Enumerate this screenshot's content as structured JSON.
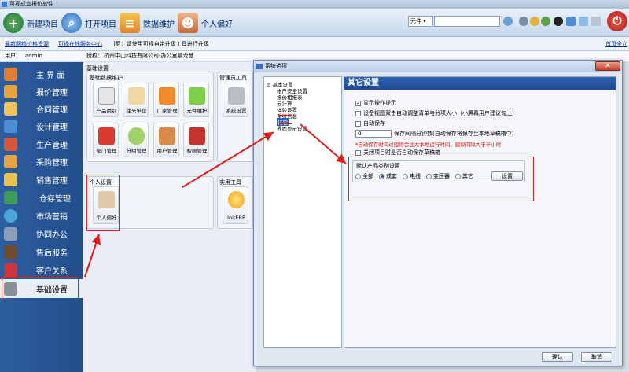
{
  "window": {
    "title": "可视成套报价软件"
  },
  "toolbar": {
    "new_project": "新建项目",
    "open_project": "打开项目",
    "data_maintenance": "数据维护",
    "preferences": "个人偏好",
    "search_select": "元件"
  },
  "linkbar": {
    "link1": "最新网络价格资源",
    "link2": "可视在线服务中心",
    "notice": "]尼：请使用可视自带升级工具进行升级",
    "right": "首页全立"
  },
  "userbar": {
    "user_label": "用户：",
    "user_value": "admin",
    "auth_label": "授权：",
    "auth_value": "杭州中山科技有限公司-办公室慕龙慧"
  },
  "sidebar": {
    "items": [
      {
        "label": "主 界 面",
        "icon": "home-icon",
        "color": "#e57b2c"
      },
      {
        "label": "报价管理",
        "icon": "quote-icon",
        "color": "#e8a23a"
      },
      {
        "label": "合同管理",
        "icon": "contract-icon",
        "color": "#f0c35a"
      },
      {
        "label": "设计管理",
        "icon": "design-icon",
        "color": "#4d8fd6"
      },
      {
        "label": "生产管理",
        "icon": "production-icon",
        "color": "#d9563b"
      },
      {
        "label": "采购管理",
        "icon": "cart-icon",
        "color": "#e7a33d"
      },
      {
        "label": "销售管理",
        "icon": "sales-icon",
        "color": "#e8c44f"
      },
      {
        "label": "仓存管理",
        "icon": "warehouse-icon",
        "color": "#3e9b5a"
      },
      {
        "label": "市场营销",
        "icon": "pie-chart-icon",
        "color": "#4aa7de"
      },
      {
        "label": "协同办公",
        "icon": "collab-icon",
        "color": "#8d9fb8"
      },
      {
        "label": "售后服务",
        "icon": "service-icon",
        "color": "#6f4c2e"
      },
      {
        "label": "客户关系",
        "icon": "customer-icon",
        "color": "#d2333e"
      },
      {
        "label": "基础设置",
        "icon": "tools-icon",
        "color": "#8a8f99"
      }
    ]
  },
  "main": {
    "section_title": "基础设置",
    "basic_data_title": "基础数据维护",
    "admin_tools_title": "管理员工具",
    "personal_title": "个人设置",
    "utility_title": "实用工具",
    "tiles": [
      {
        "label": "产品类别"
      },
      {
        "label": "往来单位"
      },
      {
        "label": "厂家管理"
      },
      {
        "label": "元件维护"
      },
      {
        "label": "部门管理"
      },
      {
        "label": "分组管理"
      },
      {
        "label": "用户管理"
      },
      {
        "label": "权限管理"
      }
    ],
    "system_settings": "系统设置",
    "personal_pref": "个人偏好",
    "init_erp": "InitERP"
  },
  "dialog": {
    "title": "系统选项",
    "tree": {
      "root": "基本设置",
      "children": [
        "帐户安全设置",
        "报价相报表",
        "云计算",
        "体验设置",
        "系统信息",
        "其它",
        "界面显示设置"
      ]
    },
    "content_title": "其它设置",
    "options": {
      "show_tip": "显示操作提示",
      "view_adjust": "设备视图双击自动调整清单与分项大小（小屏幕用户建议勾上）",
      "autosave": "自动保存",
      "autosave_value": "0",
      "autosave_suffix": "保存间隔分钟数(自动保存将保存至本地草稿箱中)",
      "warning": "*自动保存时间过短将会加大本地运行时间，建议间隔大于半小时",
      "close_prompt": "关闭项目时是否自动保存草稿箱"
    },
    "category": {
      "title": "默认产品类别设置",
      "options": [
        "全部",
        "成套",
        "电线",
        "变压器",
        "其它"
      ],
      "selected": "成套",
      "set_button": "设置"
    },
    "ok": "确认",
    "cancel": "取消"
  }
}
